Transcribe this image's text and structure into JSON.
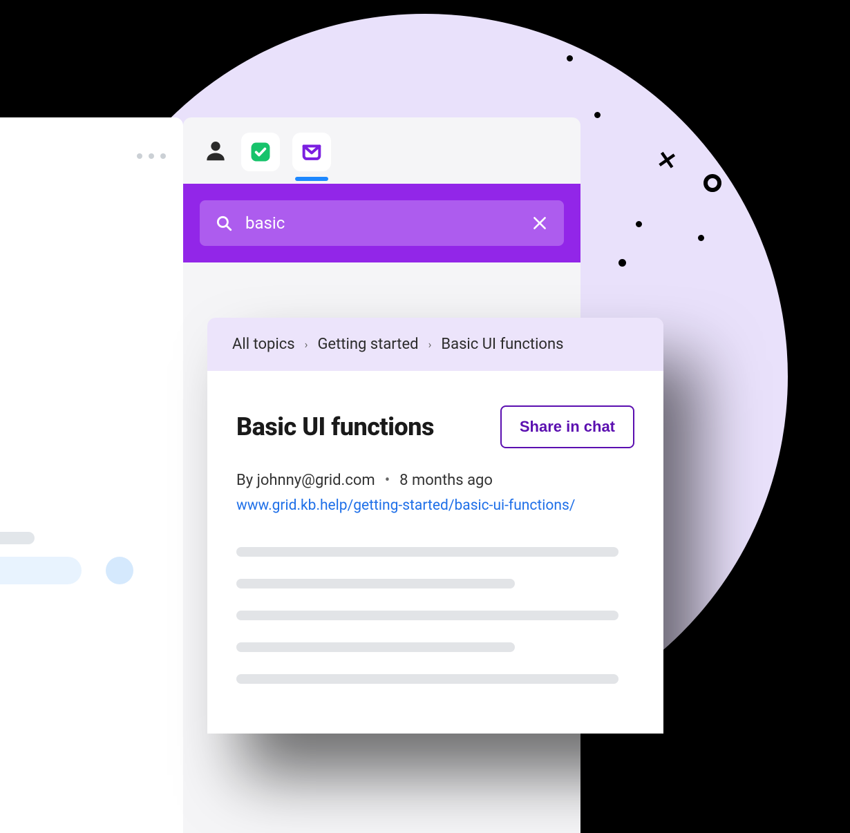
{
  "toolbar": {
    "icons": {
      "person": "person-icon",
      "checklist": "checklist-app-icon",
      "inbox": "inbox-app-icon"
    }
  },
  "search": {
    "value": "basic"
  },
  "breadcrumb": {
    "items": [
      "All topics",
      "Getting started",
      "Basic UI functions"
    ]
  },
  "article": {
    "title": "Basic UI functions",
    "share_label": "Share in chat",
    "author_prefix": "By ",
    "author": "johnny@grid.com",
    "age": "8 months ago",
    "url": "www.grid.kb.help/getting-started/basic-ui-functions/"
  }
}
